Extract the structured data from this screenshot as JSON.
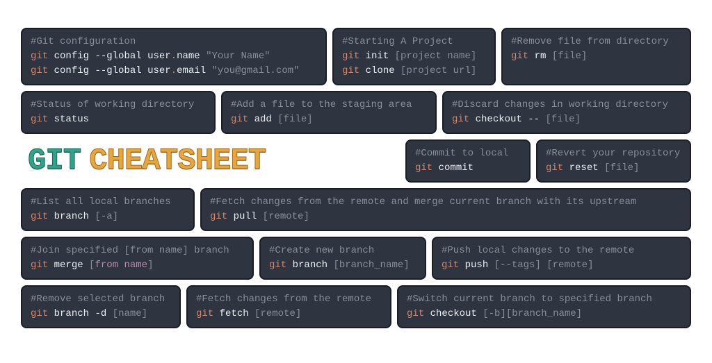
{
  "title": {
    "word1": "GIT",
    "word2": "CHEATSHEET"
  },
  "cards": {
    "config": {
      "comment": "#Git configuration",
      "l1": {
        "kw": "git",
        "sub": "config",
        "op": "--global",
        "arg": "user",
        "dot": ".",
        "field": "name",
        "val": "\"Your Name\""
      },
      "l2": {
        "kw": "git",
        "sub": "config",
        "op": "--global",
        "arg": "user",
        "dot": ".",
        "field": "email",
        "val": "\"you@gmail.com\""
      }
    },
    "start": {
      "comment": "#Starting A Project",
      "l1": {
        "kw": "git",
        "sub": "init",
        "arg": "[project name]"
      },
      "l2": {
        "kw": "git",
        "sub": "clone",
        "arg": "[project url]"
      }
    },
    "remove": {
      "comment": "#Remove file from directory",
      "l1": {
        "kw": "git",
        "sub": "rm",
        "arg": "[file]"
      }
    },
    "status": {
      "comment": "#Status of working directory",
      "l1": {
        "kw": "git",
        "sub": "status"
      }
    },
    "add": {
      "comment": "#Add a file to the staging area",
      "l1": {
        "kw": "git",
        "sub": "add",
        "arg": "[file]"
      }
    },
    "discard": {
      "comment": "#Discard changes in working directory",
      "l1": {
        "kw": "git",
        "sub": "checkout",
        "op": "--",
        "arg": "[file]"
      }
    },
    "commit": {
      "comment": "#Commit to local",
      "l1": {
        "kw": "git",
        "sub": "commit"
      }
    },
    "revert": {
      "comment": "#Revert your repository",
      "l1": {
        "kw": "git",
        "sub": "reset",
        "arg": "[file]"
      }
    },
    "branchlist": {
      "comment": "#List all local branches",
      "l1": {
        "kw": "git",
        "sub": "branch",
        "arg": "[-a]"
      }
    },
    "pull": {
      "comment": "#Fetch changes from the remote and merge current branch with its upstream",
      "l1": {
        "kw": "git",
        "sub": "pull",
        "arg": "[remote]"
      }
    },
    "merge": {
      "comment": "#Join specified [from name] branch",
      "l1": {
        "kw": "git",
        "sub": "merge",
        "arg_pre": "[",
        "var": "from name",
        "arg_post": "]"
      }
    },
    "branchnew": {
      "comment": "#Create new branch",
      "l1": {
        "kw": "git",
        "sub": "branch",
        "arg": "[branch_name]"
      }
    },
    "push": {
      "comment": "#Push local changes to the remote",
      "l1": {
        "kw": "git",
        "sub": "push",
        "arg": "[--tags] [remote]"
      }
    },
    "branchdel": {
      "comment": "#Remove selected branch",
      "l1": {
        "kw": "git",
        "sub": "branch",
        "op": "-d",
        "arg": "[name]"
      }
    },
    "fetch": {
      "comment": "#Fetch changes from the remote",
      "l1": {
        "kw": "git",
        "sub": "fetch",
        "arg": "[remote]"
      }
    },
    "checkout": {
      "comment": "#Switch current branch to specified branch",
      "l1": {
        "kw": "git",
        "sub": "checkout",
        "arg": "[-b][branch_name]"
      }
    }
  }
}
